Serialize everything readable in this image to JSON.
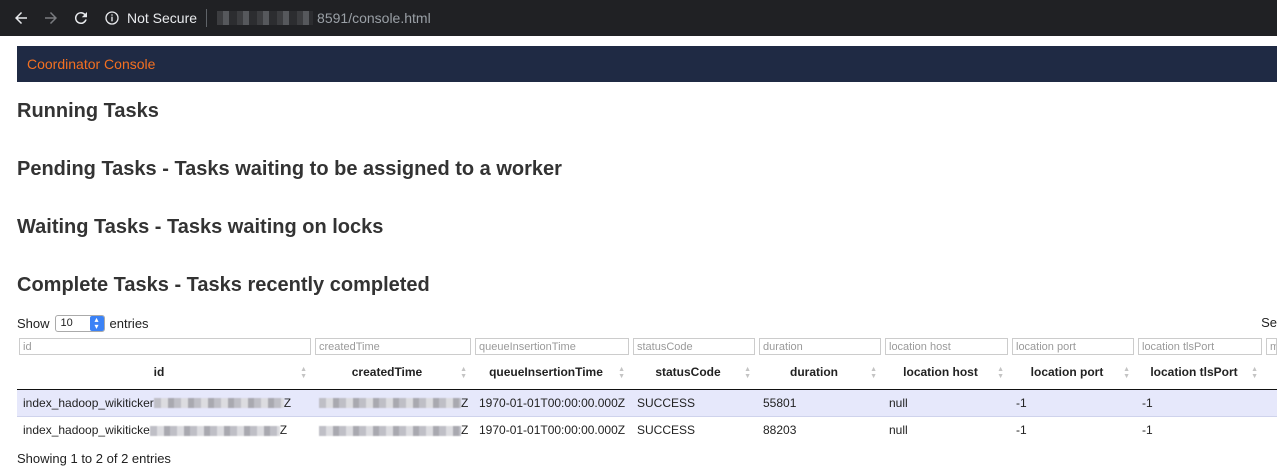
{
  "browser": {
    "security_label": "Not Secure",
    "url_path": "8591/console.html"
  },
  "banner": {
    "title": "Coordinator Console"
  },
  "sections": {
    "running": "Running Tasks",
    "pending": "Pending Tasks - Tasks waiting to be assigned to a worker",
    "waiting": "Waiting Tasks - Tasks waiting on locks",
    "complete": "Complete Tasks - Tasks recently completed"
  },
  "length": {
    "show_label": "Show",
    "value": "10",
    "entries_label": "entries",
    "search_label": "Se"
  },
  "table": {
    "filters": [
      "id",
      "createdTime",
      "queueInsertionTime",
      "statusCode",
      "duration",
      "location host",
      "location port",
      "location tlsPort",
      "m"
    ],
    "headers": [
      "id",
      "createdTime",
      "queueInsertionTime",
      "statusCode",
      "duration",
      "location host",
      "location port",
      "location tlsPort"
    ],
    "rows": [
      {
        "id_prefix": "index_hadoop_wikiticker",
        "id_suffix": "Z",
        "created_suffix": "Z",
        "queue": "1970-01-01T00:00:00.000Z",
        "status": "SUCCESS",
        "duration": "55801",
        "host": "null",
        "port": "-1",
        "tls": "-1"
      },
      {
        "id_prefix": "index_hadoop_wikiticke",
        "id_suffix": "Z",
        "created_suffix": "Z",
        "queue": "1970-01-01T00:00:00.000Z",
        "status": "SUCCESS",
        "duration": "88203",
        "host": "null",
        "port": "-1",
        "tls": "-1"
      }
    ]
  },
  "footer": {
    "info": "Showing 1 to 2 of 2 entries"
  },
  "colors": {
    "banner_bg": "#1f2a44",
    "banner_text": "#f37021",
    "row_highlight": "#e6e8fb"
  }
}
